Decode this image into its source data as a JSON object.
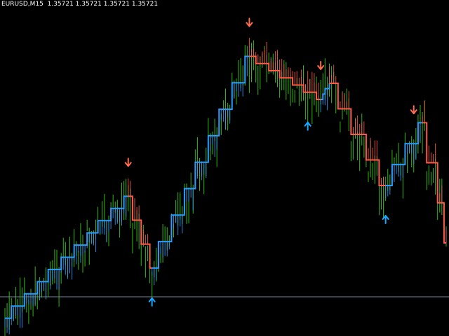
{
  "header": {
    "symbol": "EURUSD,M15",
    "open": "1.35721",
    "high": "1.35721",
    "low": "1.35721",
    "close": "1.35721"
  },
  "colors": {
    "background": "#000000",
    "bar": "#2fb80f",
    "trend_up": "#2b9cff",
    "trend_down": "#ff5a4a",
    "signal_up": "#19a8ff",
    "signal_down": "#ff6b4e",
    "level_line": "#6f8aa0"
  },
  "chart_data": {
    "type": "line",
    "symbol": "EURUSD",
    "timeframe": "M15",
    "y_range_relative": [
      0,
      100
    ],
    "bar_count": 205,
    "trend_line": {
      "segments": [
        {
          "direction": "up",
          "bar_range": [
            0,
            57
          ],
          "level_range": [
            6,
            74
          ]
        },
        {
          "direction": "down",
          "bar_range": [
            57,
            68
          ],
          "level_range": [
            74,
            34
          ]
        },
        {
          "direction": "up",
          "bar_range": [
            68,
            113
          ],
          "level_range": [
            34,
            152
          ]
        },
        {
          "direction": "down",
          "bar_range": [
            113,
            146
          ],
          "level_range": [
            152,
            128
          ]
        },
        {
          "direction": "up",
          "bar_range": [
            146,
            150
          ],
          "level_range": [
            128,
            137
          ]
        },
        {
          "direction": "down",
          "bar_range": [
            150,
            176
          ],
          "level_range": [
            137,
            80
          ]
        },
        {
          "direction": "up",
          "bar_range": [
            176,
            193
          ],
          "level_range": [
            80,
            115
          ]
        },
        {
          "direction": "down",
          "bar_range": [
            193,
            205
          ],
          "level_range": [
            115,
            48
          ]
        }
      ]
    },
    "signals": [
      {
        "type": "sell",
        "bar": 57
      },
      {
        "type": "buy",
        "bar": 68
      },
      {
        "type": "sell",
        "bar": 113
      },
      {
        "type": "sell",
        "bar": 146
      },
      {
        "type": "buy",
        "bar": 140
      },
      {
        "type": "buy",
        "bar": 176
      },
      {
        "type": "sell",
        "bar": 189
      }
    ],
    "horizontal_level": "1.35721"
  }
}
